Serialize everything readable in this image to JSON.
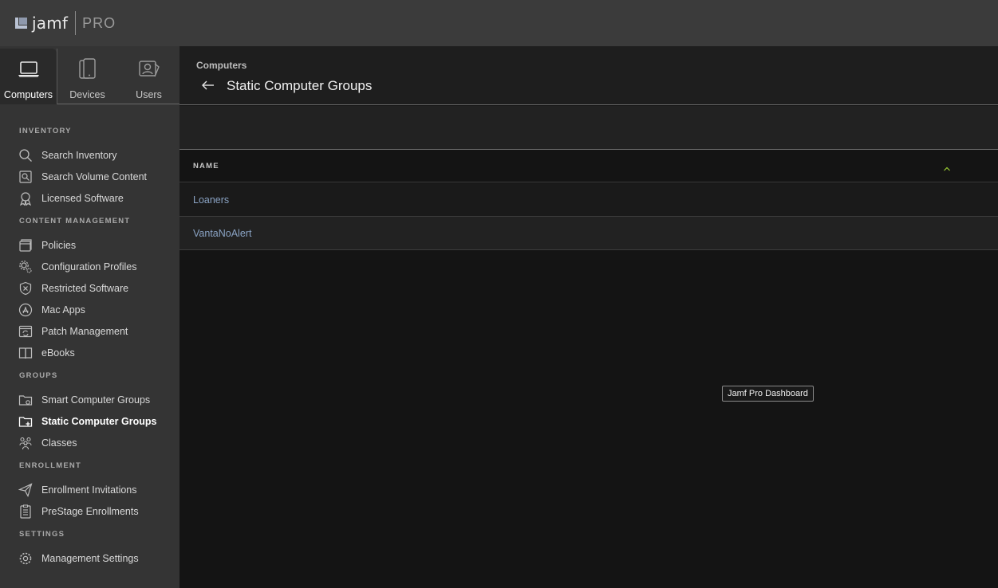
{
  "app": {
    "logo_word": "jamf",
    "logo_suffix": "PRO"
  },
  "nav_tabs": [
    {
      "label": "Computers",
      "icon": "laptop-icon",
      "active": true
    },
    {
      "label": "Devices",
      "icon": "mobile-devices-icon",
      "active": false
    },
    {
      "label": "Users",
      "icon": "user-card-icon",
      "active": false
    }
  ],
  "sidebar": {
    "sections": {
      "inventory": "INVENTORY",
      "content_management": "CONTENT MANAGEMENT",
      "groups": "GROUPS",
      "enrollment": "ENROLLMENT",
      "settings": "SETTINGS"
    },
    "items": {
      "search_inventory": "Search Inventory",
      "search_volume_content": "Search Volume Content",
      "licensed_software": "Licensed Software",
      "policies": "Policies",
      "configuration_profiles": "Configuration Profiles",
      "restricted_software": "Restricted Software",
      "mac_apps": "Mac Apps",
      "patch_management": "Patch Management",
      "ebooks": "eBooks",
      "smart_computer_groups": "Smart Computer Groups",
      "static_computer_groups": "Static Computer Groups",
      "classes": "Classes",
      "enrollment_invitations": "Enrollment Invitations",
      "prestage_enrollments": "PreStage Enrollments",
      "management_settings": "Management Settings"
    },
    "active_item": "Static Computer Groups"
  },
  "header": {
    "breadcrumb": "Computers",
    "title": "Static Computer Groups"
  },
  "table": {
    "columns": [
      "NAME"
    ],
    "sort": "ascending",
    "rows": [
      {
        "name": "Loaners"
      },
      {
        "name": "VantaNoAlert"
      }
    ]
  },
  "tooltip": "Jamf Pro Dashboard",
  "colors": {
    "topbar": "#3b3b3b",
    "sidebar": "#343434",
    "link": "#8aa3c4",
    "sort_accent": "#9acd32"
  }
}
